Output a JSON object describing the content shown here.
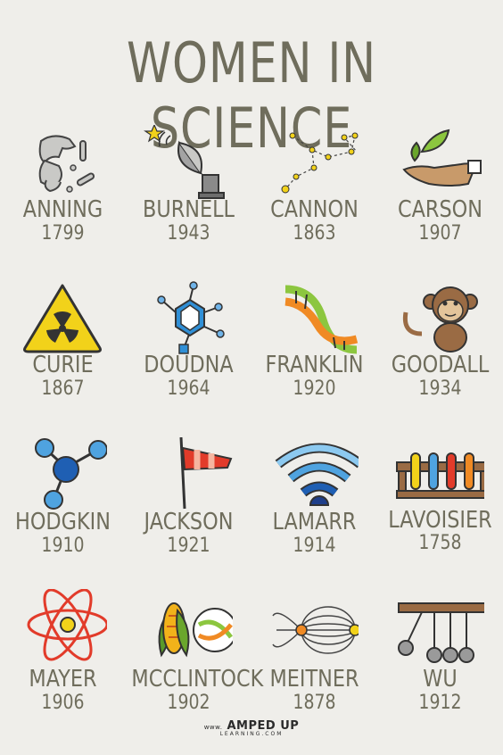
{
  "title": "WOMEN IN SCIENCE",
  "scientists": [
    {
      "name": "ANNING",
      "year": "1799",
      "icon": "fossil-icon"
    },
    {
      "name": "BURNELL",
      "year": "1943",
      "icon": "radio-telescope-icon"
    },
    {
      "name": "CANNON",
      "year": "1863",
      "icon": "constellation-icon"
    },
    {
      "name": "CARSON",
      "year": "1907",
      "icon": "hand-leaf-icon"
    },
    {
      "name": "CURIE",
      "year": "1867",
      "icon": "radiation-icon"
    },
    {
      "name": "DOUDNA",
      "year": "1964",
      "icon": "molecule-icon"
    },
    {
      "name": "FRANKLIN",
      "year": "1920",
      "icon": "dna-icon"
    },
    {
      "name": "GOODALL",
      "year": "1934",
      "icon": "monkey-icon"
    },
    {
      "name": "HODGKIN",
      "year": "1910",
      "icon": "atoms-model-icon"
    },
    {
      "name": "JACKSON",
      "year": "1921",
      "icon": "windsock-icon"
    },
    {
      "name": "LAMARR",
      "year": "1914",
      "icon": "wifi-icon"
    },
    {
      "name": "LAVOISIER",
      "year": "1758",
      "icon": "test-tubes-icon"
    },
    {
      "name": "MAYER",
      "year": "1906",
      "icon": "atom-icon"
    },
    {
      "name": "MCCLINTOCK",
      "year": "1902",
      "icon": "corn-dna-icon"
    },
    {
      "name": "MEITNER",
      "year": "1878",
      "icon": "magnetic-field-icon"
    },
    {
      "name": "WU",
      "year": "1912",
      "icon": "newtons-cradle-icon"
    }
  ],
  "logo": {
    "prefix": "www.",
    "main": "AMPED UP",
    "sub": "LEARNING.COM"
  },
  "colors": {
    "background": "#efeeea",
    "text": "#6f6d5c"
  }
}
